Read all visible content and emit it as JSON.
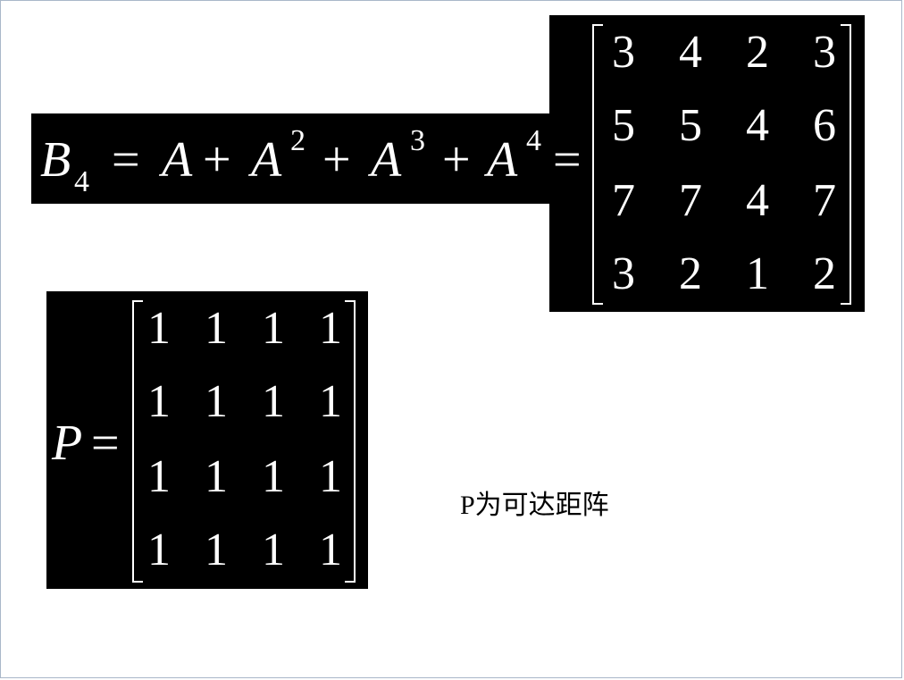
{
  "b4_equation": {
    "lhs_symbol": "B",
    "lhs_subscript": "4",
    "equals": "=",
    "terms": [
      {
        "base": "A",
        "exp": ""
      },
      {
        "base": "A",
        "exp": "2"
      },
      {
        "base": "A",
        "exp": "3"
      },
      {
        "base": "A",
        "exp": "4"
      }
    ],
    "plus": "+",
    "matrix": [
      [
        "3",
        "4",
        "2",
        "3"
      ],
      [
        "5",
        "5",
        "4",
        "6"
      ],
      [
        "7",
        "7",
        "4",
        "7"
      ],
      [
        "3",
        "2",
        "1",
        "2"
      ]
    ]
  },
  "p_equation": {
    "symbol": "P",
    "equals": "=",
    "matrix": [
      [
        "1",
        "1",
        "1",
        "1"
      ],
      [
        "1",
        "1",
        "1",
        "1"
      ],
      [
        "1",
        "1",
        "1",
        "1"
      ],
      [
        "1",
        "1",
        "1",
        "1"
      ]
    ]
  },
  "caption": "P为可达距阵",
  "colors": {
    "equation_bg": "#000000",
    "equation_fg": "#ffffff",
    "slide_bg": "#ffffff",
    "caption_fg": "#000000"
  }
}
